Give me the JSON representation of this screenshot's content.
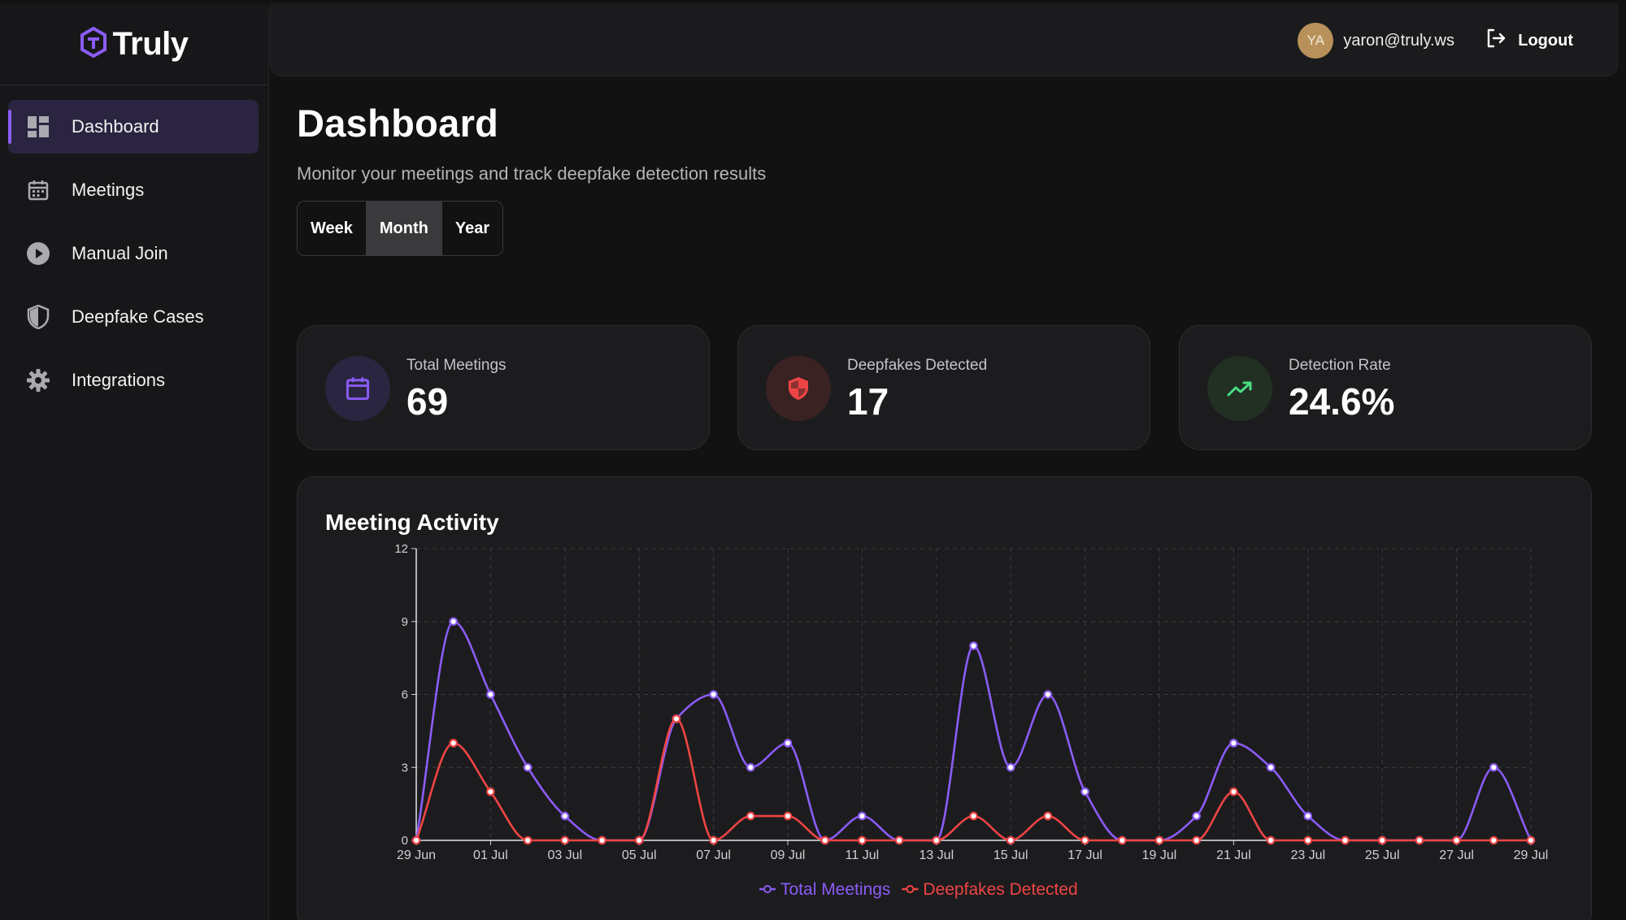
{
  "app": {
    "name": "Truly"
  },
  "sidebar": {
    "items": [
      {
        "label": "Dashboard",
        "icon": "dashboard-icon",
        "active": true
      },
      {
        "label": "Meetings",
        "icon": "calendar-icon",
        "active": false
      },
      {
        "label": "Manual Join",
        "icon": "play-circle-icon",
        "active": false
      },
      {
        "label": "Deepfake Cases",
        "icon": "shield-icon",
        "active": false
      },
      {
        "label": "Integrations",
        "icon": "gear-icon",
        "active": false
      }
    ]
  },
  "header": {
    "avatar_initials": "YA",
    "user_email": "yaron@truly.ws",
    "logout_label": "Logout"
  },
  "page": {
    "title": "Dashboard",
    "subtitle": "Monitor your meetings and track deepfake detection results",
    "ranges": [
      "Week",
      "Month",
      "Year"
    ],
    "selected_range": "Month"
  },
  "stats": [
    {
      "label": "Total Meetings",
      "value": "69",
      "icon": "calendar-icon",
      "color": "#8b5cf6"
    },
    {
      "label": "Deepfakes Detected",
      "value": "17",
      "icon": "shield-icon",
      "color": "#ef4444"
    },
    {
      "label": "Detection Rate",
      "value": "24.6%",
      "icon": "trending-up-icon",
      "color": "#4ade80"
    }
  ],
  "colors": {
    "accent": "#8b5cf6",
    "danger": "#ef4444",
    "success": "#4ade80"
  },
  "chart_data": {
    "type": "line",
    "title": "Meeting Activity",
    "x": [
      "29 Jun",
      "30 Jun",
      "01 Jul",
      "02 Jul",
      "03 Jul",
      "04 Jul",
      "05 Jul",
      "06 Jul",
      "07 Jul",
      "08 Jul",
      "09 Jul",
      "10 Jul",
      "11 Jul",
      "12 Jul",
      "13 Jul",
      "14 Jul",
      "15 Jul",
      "16 Jul",
      "17 Jul",
      "18 Jul",
      "19 Jul",
      "20 Jul",
      "21 Jul",
      "22 Jul",
      "23 Jul",
      "24 Jul",
      "25 Jul",
      "26 Jul",
      "27 Jul",
      "28 Jul",
      "29 Jul"
    ],
    "x_tick_labels": [
      "29 Jun",
      "01 Jul",
      "03 Jul",
      "05 Jul",
      "07 Jul",
      "09 Jul",
      "11 Jul",
      "13 Jul",
      "15 Jul",
      "17 Jul",
      "19 Jul",
      "21 Jul",
      "23 Jul",
      "25 Jul",
      "27 Jul",
      "29 Jul"
    ],
    "y_ticks": [
      "0",
      "3",
      "6",
      "9",
      "12"
    ],
    "ylim": [
      0,
      12
    ],
    "grid": true,
    "legend_position": "bottom-center",
    "series": [
      {
        "name": "Total Meetings",
        "color": "#8b5cf6",
        "values": [
          0,
          9,
          6,
          3,
          1,
          0,
          0,
          5,
          6,
          3,
          4,
          0,
          1,
          0,
          0,
          8,
          3,
          6,
          2,
          0,
          0,
          1,
          4,
          3,
          1,
          0,
          0,
          0,
          0,
          3,
          0
        ]
      },
      {
        "name": "Deepfakes Detected",
        "color": "#ef4444",
        "values": [
          0,
          4,
          2,
          0,
          0,
          0,
          0,
          5,
          0,
          1,
          1,
          0,
          0,
          0,
          0,
          1,
          0,
          1,
          0,
          0,
          0,
          0,
          2,
          0,
          0,
          0,
          0,
          0,
          0,
          0,
          0
        ]
      }
    ]
  }
}
